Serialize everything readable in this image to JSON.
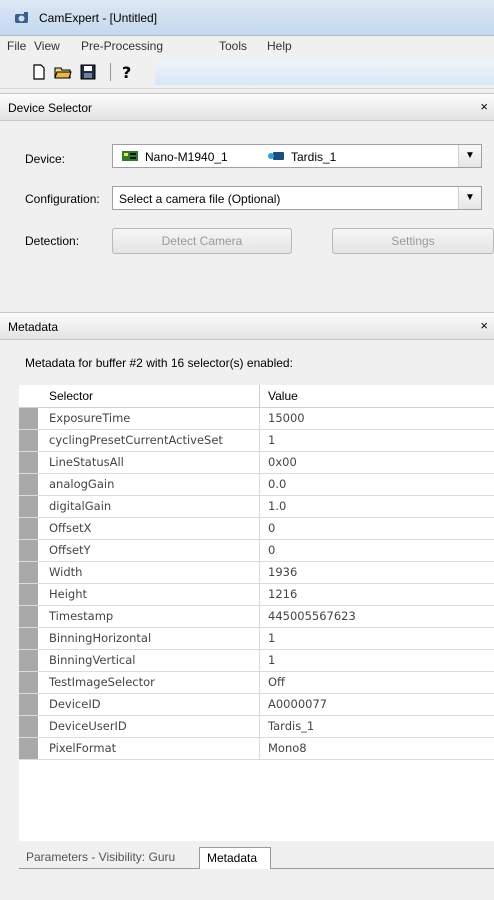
{
  "window": {
    "title": "CamExpert - [Untitled]"
  },
  "menu": [
    "File",
    "View",
    "Pre-Processing",
    "Tools",
    "Help"
  ],
  "toolbar": {
    "new_icon": "new-doc-icon",
    "open_icon": "open-folder-icon",
    "save_icon": "save-disk-icon",
    "help_icon": "help-question-icon"
  },
  "device_selector": {
    "title": "Device Selector",
    "close": "×",
    "device_label": "Device:",
    "device_value": "Nano-M1940_1",
    "device_server": "Tardis_1",
    "config_label": "Configuration:",
    "config_value": "Select a camera file (Optional)",
    "detection_label": "Detection:",
    "detect_button": "Detect Camera",
    "settings_button": "Settings"
  },
  "metadata": {
    "title": "Metadata",
    "close": "×",
    "summary": "Metadata for buffer #2 with 16 selector(s) enabled:",
    "columns": [
      "Selector",
      "Value"
    ],
    "rows": [
      [
        "ExposureTime",
        "15000"
      ],
      [
        "cyclingPresetCurrentActiveSet",
        "1"
      ],
      [
        "LineStatusAll",
        "0x00"
      ],
      [
        "analogGain",
        "0.0"
      ],
      [
        "digitalGain",
        "1.0"
      ],
      [
        "OffsetX",
        "0"
      ],
      [
        "OffsetY",
        "0"
      ],
      [
        "Width",
        "1936"
      ],
      [
        "Height",
        "1216"
      ],
      [
        "Timestamp",
        "445005567623"
      ],
      [
        "BinningHorizontal",
        "1"
      ],
      [
        "BinningVertical",
        "1"
      ],
      [
        "TestImageSelector",
        "Off"
      ],
      [
        "DeviceID",
        "A0000077"
      ],
      [
        "DeviceUserID",
        "Tardis_1"
      ],
      [
        "PixelFormat",
        "Mono8"
      ]
    ]
  },
  "tabs": [
    "Parameters - Visibility: Guru",
    "Metadata"
  ]
}
